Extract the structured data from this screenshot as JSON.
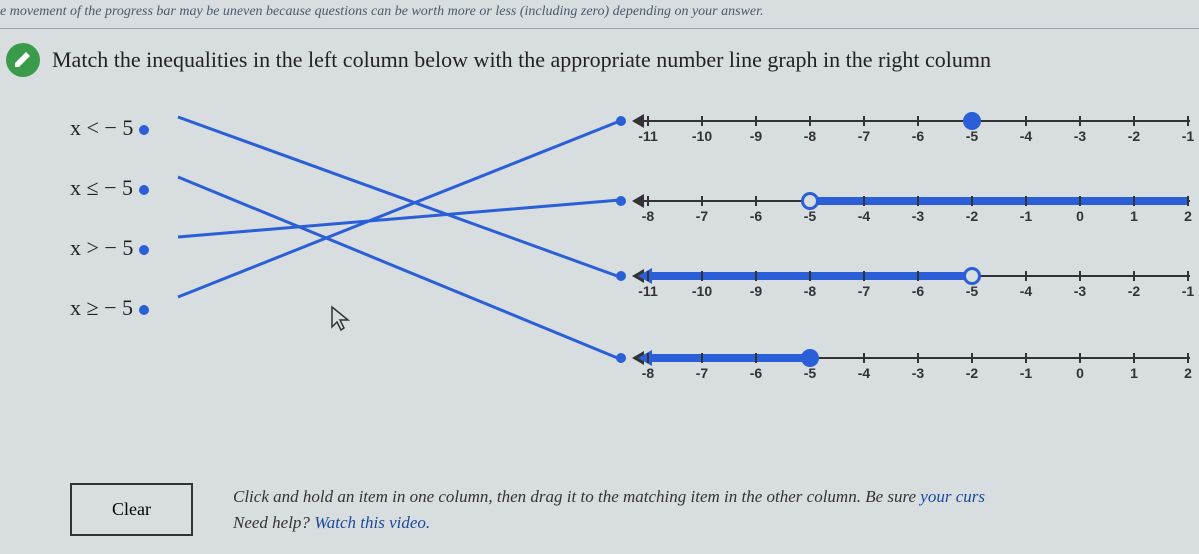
{
  "progress_note": "e movement of the progress bar may be uneven because questions can be worth more or less (including zero) depending on your answer.",
  "question": "Match the inequalities in the left column below with the appropriate number line graph in the right column",
  "inequalities": [
    {
      "label": "x <  − 5"
    },
    {
      "label": "x ≤  − 5"
    },
    {
      "label": "x >  − 5"
    },
    {
      "label": "x ≥  − 5"
    }
  ],
  "number_lines": [
    {
      "start": -11,
      "end": -1,
      "point": -5,
      "closed": true,
      "direction": "none_shade_left_of_point_false",
      "ticks": [
        -11,
        -10,
        -9,
        -8,
        -7,
        -6,
        -5,
        -4,
        -3,
        -2,
        -1
      ]
    },
    {
      "start": -8,
      "end": 2,
      "point": -5,
      "closed": false,
      "direction": "right",
      "ticks": [
        -8,
        -7,
        -6,
        -5,
        -4,
        -3,
        -2,
        -1,
        0,
        1,
        2
      ]
    },
    {
      "start": -11,
      "end": -1,
      "point": -5,
      "closed": false,
      "direction": "left",
      "ticks": [
        -11,
        -10,
        -9,
        -8,
        -7,
        -6,
        -5,
        -4,
        -3,
        -2,
        -1
      ]
    },
    {
      "start": -8,
      "end": 2,
      "point": -5,
      "closed": true,
      "direction": "left",
      "ticks": [
        -8,
        -7,
        -6,
        -5,
        -4,
        -3,
        -2,
        -1,
        0,
        1,
        2
      ]
    }
  ],
  "matches": [
    {
      "from": 0,
      "to": 2
    },
    {
      "from": 1,
      "to": 3
    },
    {
      "from": 2,
      "to": 1
    },
    {
      "from": 3,
      "to": 0
    }
  ],
  "clear_label": "Clear",
  "instructions_line1_a": "Click and hold an item in one column, then drag it to the matching item in the other column. Be sure ",
  "instructions_line1_b": "your curs",
  "instructions_line2_a": "Need help? ",
  "instructions_line2_b": "Watch this video."
}
